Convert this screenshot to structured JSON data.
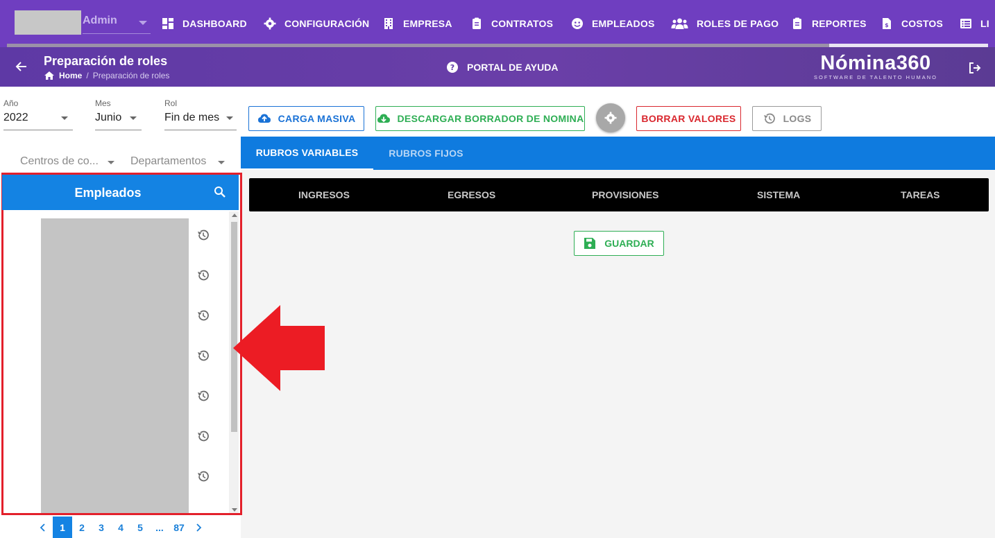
{
  "topnav": {
    "user_role": "Admin",
    "menu": [
      {
        "label": "DASHBOARD",
        "icon": "dashboard-icon"
      },
      {
        "label": "CONFIGURACIÓN",
        "icon": "gear-icon"
      },
      {
        "label": "EMPRESA",
        "icon": "building-icon"
      },
      {
        "label": "CONTRATOS",
        "icon": "clipboard-icon"
      },
      {
        "label": "EMPLEADOS",
        "icon": "users-face-icon"
      },
      {
        "label": "ROLES DE PAGO",
        "icon": "users-group-icon"
      },
      {
        "label": "REPORTES",
        "icon": "clipboard-icon"
      },
      {
        "label": "COSTOS",
        "icon": "file-dollar-icon"
      },
      {
        "label": "LI",
        "icon": "list-icon"
      }
    ]
  },
  "subheader": {
    "title": "Preparación de roles",
    "breadcrumb_home": "Home",
    "breadcrumb_sep": "/",
    "breadcrumb_current": "Preparación de roles",
    "help_label": "PORTAL DE AYUDA",
    "brand_name": "Nómina360",
    "brand_tagline": "SOFTWARE DE TALENTO HUMANO"
  },
  "filters": {
    "year_label": "Año",
    "year_value": "2022",
    "month_label": "Mes",
    "month_value": "Junio",
    "role_label": "Rol",
    "role_value": "Fin de mes",
    "cost_center_placeholder": "Centros de co...",
    "department_placeholder": "Departamentos"
  },
  "actions": {
    "bulk_upload": "CARGA MASIVA",
    "download_draft": "DESCARGAR BORRADOR DE NOMINA",
    "clear_values": "BORRAR VALORES",
    "logs": "LOGS"
  },
  "tabs": [
    "RUBROS VARIABLES",
    "RUBROS FIJOS"
  ],
  "subtabs": [
    "INGRESOS",
    "EGRESOS",
    "PROVISIONES",
    "SISTEMA",
    "TAREAS"
  ],
  "save_label": "GUARDAR",
  "employees_panel": {
    "title": "Empleados"
  },
  "pagination": [
    "1",
    "2",
    "3",
    "4",
    "5",
    "...",
    "87"
  ],
  "colors": {
    "nav_purple": "#6f3ec0",
    "tab_blue": "#0f7bdf",
    "green": "#2eae54",
    "red": "#e3202b"
  }
}
